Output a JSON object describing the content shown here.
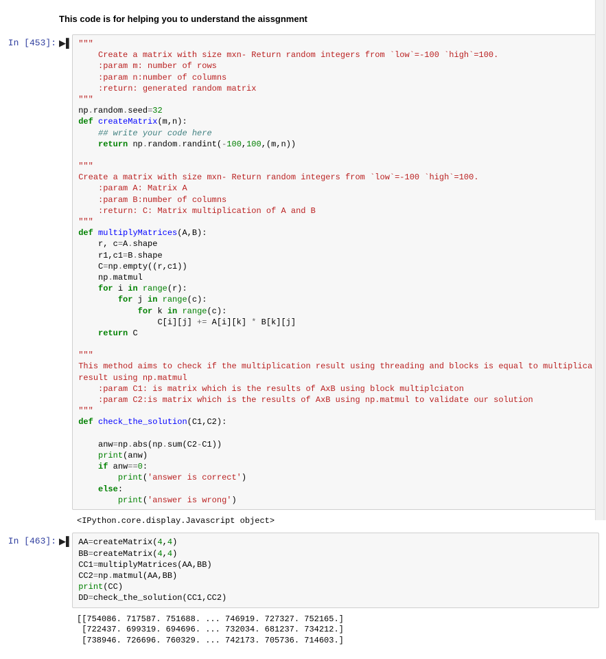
{
  "header": {
    "title": "This code is for helping you to understand the aissgnment"
  },
  "cells": [
    {
      "prompt": "In [453]:",
      "code": {
        "l01": "\"\"\"",
        "l02": "    Create a matrix with size mxn- Return random integers from `low`=-100 `high`=100.",
        "l03": "    :param m: number of rows",
        "l04": "    :param n:number of columns",
        "l05": "    :return: generated random matrix",
        "l06": "\"\"\"",
        "l07_a": "np",
        "l07_op1": ".",
        "l07_b": "random",
        "l07_op2": ".",
        "l07_c": "seed",
        "l07_op3": "=",
        "l07_d": "32",
        "l08_kw": "def",
        "l08_name": " createMatrix",
        "l08_rest": "(m,n):",
        "l09": "    ## write your code here",
        "l10_pre": "    ",
        "l10_kw": "return",
        "l10_a": " np",
        "l10_op1": ".",
        "l10_b": "random",
        "l10_op2": ".",
        "l10_c": "randint(",
        "l10_n1": "-",
        "l10_n1b": "100",
        "l10_c1": ",",
        "l10_n2": "100",
        "l10_c2": ",(m,n))",
        "l12": "\"\"\"",
        "l13": "Create a matrix with size mxn- Return random integers from `low`=-100 `high`=100.",
        "l14": "    :param A: Matrix A",
        "l15": "    :param B:number of columns",
        "l16": "    :return: C: Matrix multiplication of A and B",
        "l17": "\"\"\"",
        "l18_kw": "def",
        "l18_name": " multiplyMatrices",
        "l18_rest": "(A,B):",
        "l19_a": "    r, c",
        "l19_op": "=",
        "l19_b": "A",
        "l19_op2": ".",
        "l19_c": "shape",
        "l20_a": "    r1,c1",
        "l20_op": "=",
        "l20_b": "B",
        "l20_op2": ".",
        "l20_c": "shape",
        "l21_a": "    C",
        "l21_op": "=",
        "l21_b": "np",
        "l21_op2": ".",
        "l21_c": "empty((r,c1))",
        "l22_a": "    np",
        "l22_op": ".",
        "l22_b": "matmul",
        "l23_pre": "    ",
        "l23_kw": "for",
        "l23_a": " i ",
        "l23_kw2": "in",
        "l23_b": " ",
        "l23_bi": "range",
        "l23_c": "(r):",
        "l24_pre": "        ",
        "l24_kw": "for",
        "l24_a": " j ",
        "l24_kw2": "in",
        "l24_b": " ",
        "l24_bi": "range",
        "l24_c": "(c):",
        "l25_pre": "            ",
        "l25_kw": "for",
        "l25_a": " k ",
        "l25_kw2": "in",
        "l25_b": " ",
        "l25_bi": "range",
        "l25_c": "(c):",
        "l26_a": "                C[i][j] ",
        "l26_op": "+=",
        "l26_b": " A[i][k] ",
        "l26_op2": "*",
        "l26_c": " B[k][j]",
        "l27_pre": "    ",
        "l27_kw": "return",
        "l27_a": " C",
        "l29": "\"\"\"",
        "l30": "This method aims to check if the multiplication result using threading and blocks is equal to multiplica",
        "l31": "result using np.matmul",
        "l32": "    :param C1: is matrix which is the results of AxB using block multiplciaton",
        "l33": "    :param C2:is matrix which is the results of AxB using np.matmul to validate our solution",
        "l34": "\"\"\"",
        "l35_kw": "def",
        "l35_name": " check_the_solution",
        "l35_rest": "(C1,C2):",
        "l37_a": "    anw",
        "l37_op": "=",
        "l37_b": "np",
        "l37_op2": ".",
        "l37_c": "abs(np",
        "l37_op3": ".",
        "l37_d": "sum(C2",
        "l37_op4": "-",
        "l37_e": "C1))",
        "l38_pre": "    ",
        "l38_bi": "print",
        "l38_a": "(anw)",
        "l39_pre": "    ",
        "l39_kw": "if",
        "l39_a": " anw",
        "l39_op": "==",
        "l39_n": "0",
        "l39_c": ":",
        "l40_pre": "        ",
        "l40_bi": "print",
        "l40_a": "(",
        "l40_s": "'answer is correct'",
        "l40_c": ")",
        "l41_pre": "    ",
        "l41_kw": "else",
        "l41_c": ":",
        "l42_pre": "        ",
        "l42_bi": "print",
        "l42_a": "(",
        "l42_s": "'answer is wrong'",
        "l42_c": ")"
      },
      "output": "<IPython.core.display.Javascript object>"
    },
    {
      "prompt": "In [463]:",
      "code": {
        "l1_a": "AA",
        "l1_op": "=",
        "l1_b": "createMatrix(",
        "l1_n1": "4",
        "l1_c": ",",
        "l1_n2": "4",
        "l1_d": ")",
        "l2_a": "BB",
        "l2_op": "=",
        "l2_b": "createMatrix(",
        "l2_n1": "4",
        "l2_c": ",",
        "l2_n2": "4",
        "l2_d": ")",
        "l3_a": "CC1",
        "l3_op": "=",
        "l3_b": "multiplyMatrices(AA,BB)",
        "l4_a": "CC2",
        "l4_op": "=",
        "l4_b": "np",
        "l4_op2": ".",
        "l4_c": "matmul(AA,BB)",
        "l5_bi": "print",
        "l5_a": "(CC)",
        "l6_a": "DD",
        "l6_op": "=",
        "l6_b": "check_the_solution(CC1,CC2)"
      },
      "output_lines": [
        "[[754086. 717587. 751688. ... 746919. 727327. 752165.]",
        " [722437. 699319. 694696. ... 732034. 681237. 734212.]",
        " [738946. 726696. 760329. ... 742173. 705736. 714603.]"
      ]
    }
  ]
}
